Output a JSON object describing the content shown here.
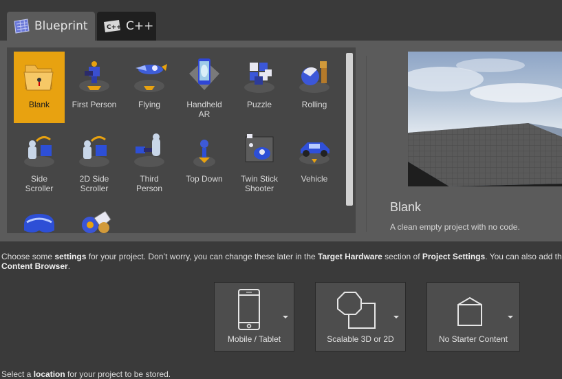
{
  "tabs": [
    {
      "label": "Blueprint",
      "icon": "blueprint-icon",
      "active": true
    },
    {
      "label": "C++",
      "icon": "cpp-icon",
      "active": false
    }
  ],
  "templates": [
    {
      "label": "Blank",
      "icon": "folder-icon",
      "selected": true
    },
    {
      "label": "First Person",
      "icon": "first-person-icon"
    },
    {
      "label": "Flying",
      "icon": "flying-icon"
    },
    {
      "label": "Handheld AR",
      "icon": "handheld-ar-icon"
    },
    {
      "label": "Puzzle",
      "icon": "puzzle-icon"
    },
    {
      "label": "Rolling",
      "icon": "rolling-icon"
    },
    {
      "label": "Side Scroller",
      "icon": "side-scroller-icon"
    },
    {
      "label": "2D Side Scroller",
      "icon": "2d-side-scroller-icon"
    },
    {
      "label": "Third Person",
      "icon": "third-person-icon"
    },
    {
      "label": "Top Down",
      "icon": "top-down-icon"
    },
    {
      "label": "Twin Stick Shooter",
      "icon": "twin-stick-shooter-icon"
    },
    {
      "label": "Vehicle",
      "icon": "vehicle-icon"
    },
    {
      "label": "",
      "icon": "vr-headset-icon"
    },
    {
      "label": "",
      "icon": "vehicle-advanced-icon"
    }
  ],
  "preview": {
    "title": "Blank",
    "description": "A clean empty project with no code."
  },
  "settings": {
    "t1": "Choose some ",
    "b1": "settings",
    "t2": " for your project.  Don’t worry, you can change these later in the ",
    "b2": "Target Hardware",
    "t3": " section of ",
    "b3": "Project Settings",
    "t4": ".  You can also add the",
    "b4": "Content Browser",
    "t5": "."
  },
  "options": [
    {
      "label": "Mobile / Tablet",
      "icon": "mobile-icon"
    },
    {
      "label": "Scalable 3D or 2D",
      "icon": "scalable-quality-icon"
    },
    {
      "label": "No Starter Content",
      "icon": "no-starter-content-icon"
    }
  ],
  "location": {
    "t1": "Select a ",
    "b1": "location",
    "t2": " for your project to be stored."
  },
  "colors": {
    "background": "#3a3a3a",
    "panel": "#5b5b5b",
    "selection": "#e8a210",
    "inactive_tab": "#1f1f1f"
  }
}
